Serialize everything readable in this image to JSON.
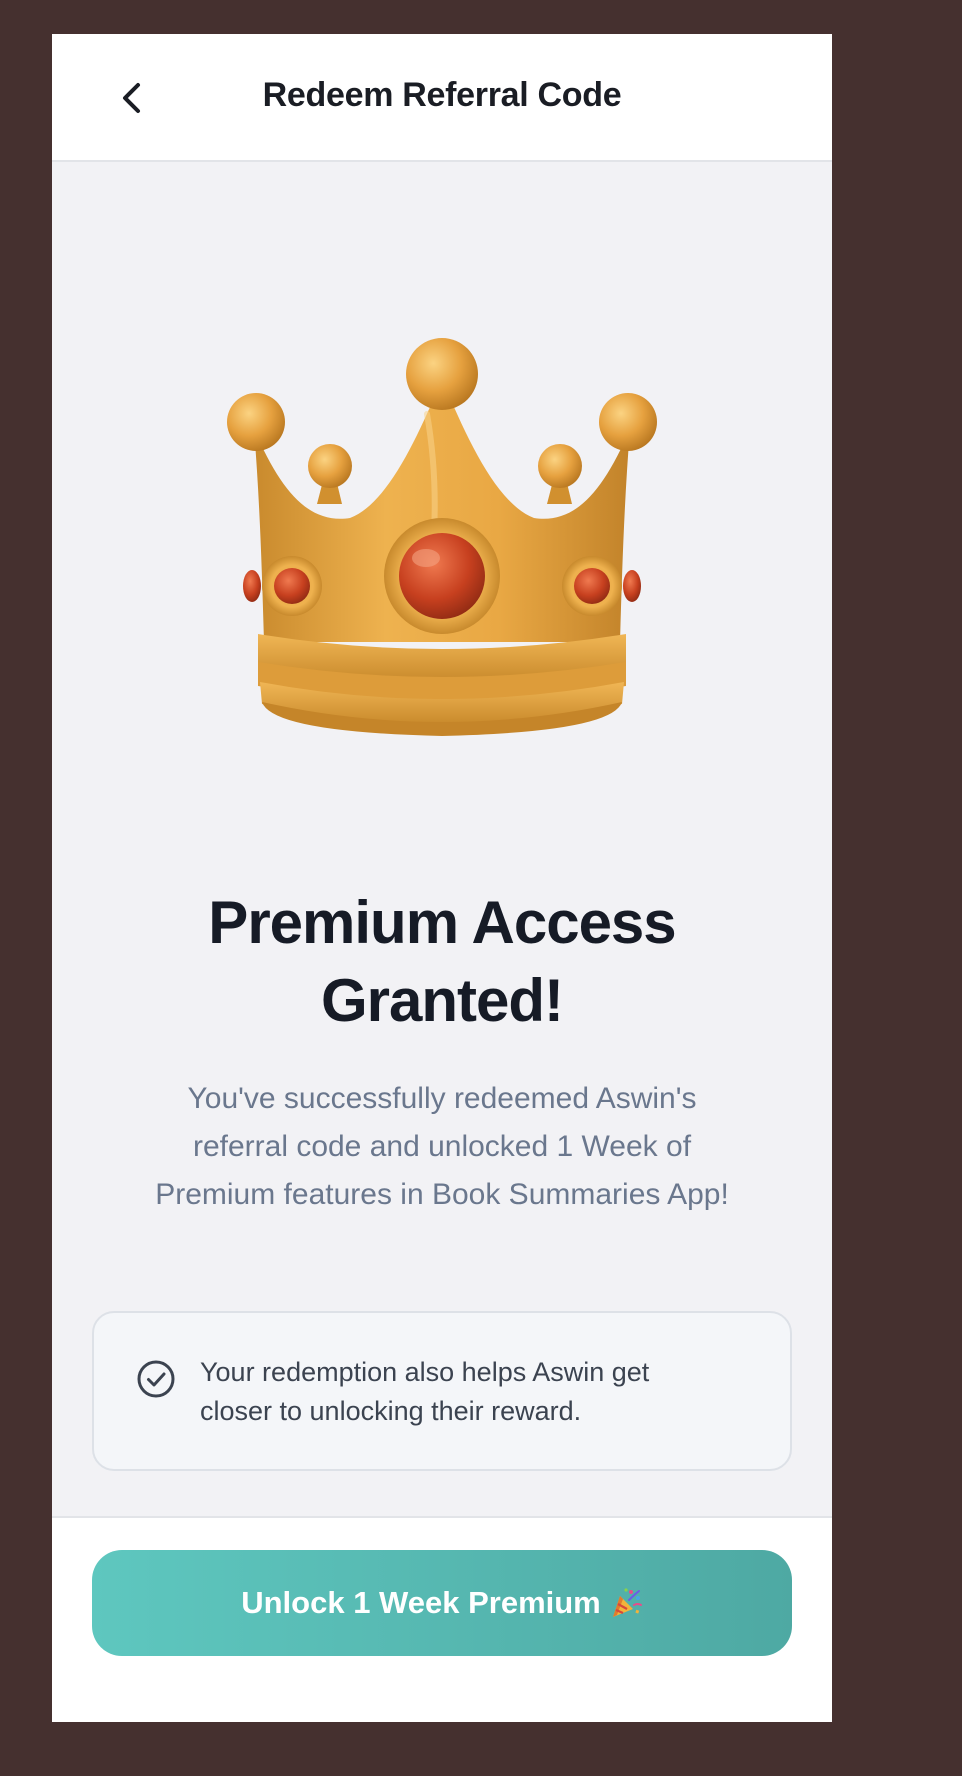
{
  "header": {
    "title": "Redeem Referral Code",
    "back_icon": "chevron-left-icon"
  },
  "hero": {
    "image_icon": "crown-icon",
    "headline_line1": "Premium Access",
    "headline_line2": "Granted!",
    "description": "You've successfully redeemed Aswin's referral code and unlocked 1 Week of Premium features in Book Summaries App!"
  },
  "info_card": {
    "icon": "check-circle-icon",
    "text": "Your redemption also helps Aswin get closer to unlocking their reward."
  },
  "cta": {
    "label": "Unlock 1 Week Premium",
    "icon": "party-popper-icon",
    "gradient": [
      "#5ec7bf",
      "#4ea9a3"
    ]
  },
  "colors": {
    "backdrop": "#45302f",
    "surface": "#f2f2f5",
    "headline": "#161b26",
    "muted": "#6a778d",
    "crown_gold": "#e3a13f",
    "gem_red": "#c7401f"
  }
}
